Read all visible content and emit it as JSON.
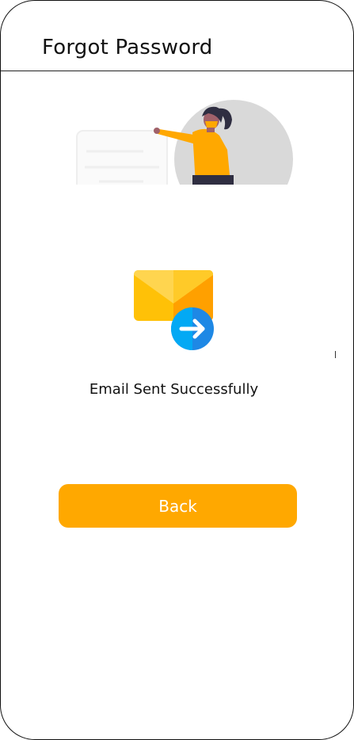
{
  "header": {
    "title": "Forgot Password"
  },
  "illustration": {
    "icon": "person-presenting-board-illustration",
    "colors": {
      "circle": "#D9D9D9",
      "shirt": "#FFA800",
      "hair": "#2F2E41",
      "skin": "#A0616A",
      "board": "#F2F2F2"
    }
  },
  "status": {
    "icon": "email-sent-icon",
    "message": "Email Sent Successfully",
    "colors": {
      "envelope_front": "#FFC107",
      "envelope_flap": "#FFD54F",
      "arrow_circle": "#1E88E5"
    }
  },
  "actions": {
    "back_label": "Back",
    "accent": "#FFA800"
  }
}
